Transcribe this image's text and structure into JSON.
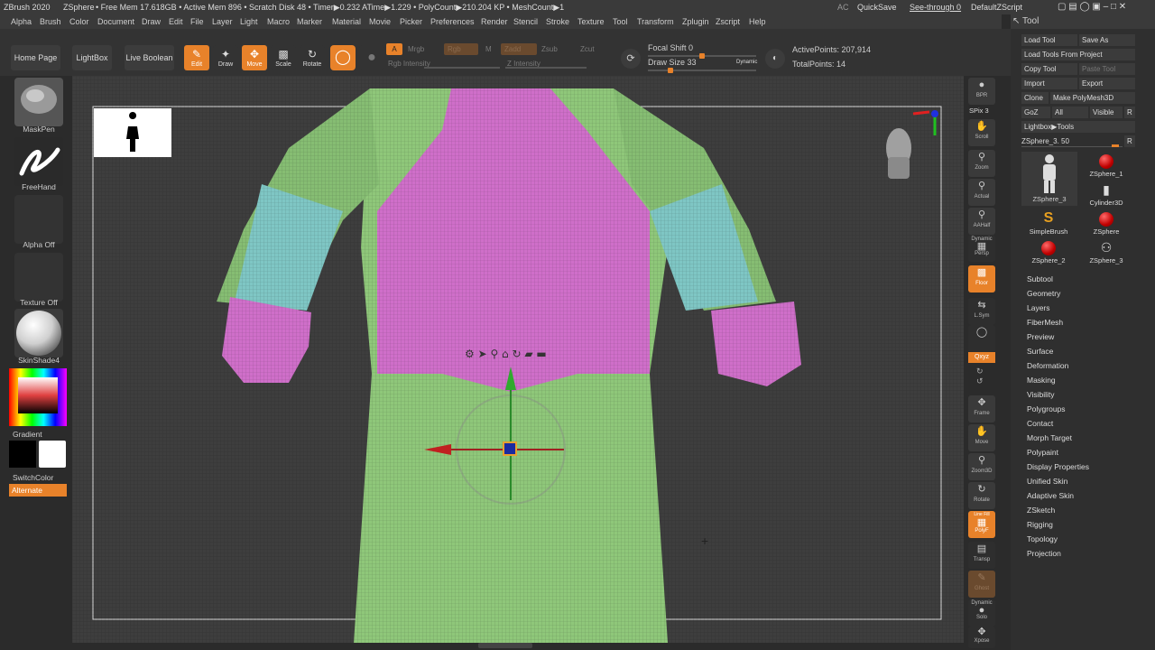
{
  "titlebar": {
    "app": "ZBrush 2020",
    "tool": "ZSphere",
    "stats": "• Free Mem 17.618GB • Active Mem 896 • Scratch Disk 48 • Timer▶0.232 ATime▶1.229 • PolyCount▶210.204 KP • MeshCount▶1",
    "ac": "AC",
    "quicksave": "QuickSave",
    "see_through": "See-through  0",
    "default_script": "DefaultZScript"
  },
  "menu": [
    "Alpha",
    "Brush",
    "Color",
    "Document",
    "Draw",
    "Edit",
    "File",
    "Layer",
    "Light",
    "Macro",
    "Marker",
    "Material",
    "Movie",
    "Picker",
    "Preferences",
    "Render",
    "Stencil",
    "Stroke",
    "Texture",
    "Tool",
    "Transform",
    "Zplugin",
    "Zscript",
    "Help"
  ],
  "toolbar": {
    "home_page": "Home Page",
    "lightbox": "LightBox",
    "live_boolean": "Live Boolean",
    "edit": "Edit",
    "draw": "Draw",
    "move": "Move",
    "scale": "Scale",
    "rotate": "Rotate",
    "a_label": "A",
    "mrgb": "Mrgb",
    "rgb": "Rgb",
    "m": "M",
    "zadd": "Zadd",
    "zsub": "Zsub",
    "zcut": "Zcut",
    "rgb_intensity": "Rgb Intensity",
    "z_intensity": "Z Intensity",
    "focal_shift": "Focal Shift 0",
    "draw_size": "Draw Size 33",
    "dynamic": "Dynamic",
    "active_points": "ActivePoints: 207,914",
    "total_points": "TotalPoints: 14"
  },
  "left": {
    "brush": "MaskPen",
    "stroke": "FreeHand",
    "alpha": "Alpha Off",
    "texture": "Texture Off",
    "material": "SkinShade4",
    "gradient": "Gradient",
    "switchcolor": "SwitchColor",
    "alternate": "Alternate"
  },
  "right": {
    "bpr": "BPR",
    "spix": "SPix 3",
    "scroll": "Scroll",
    "zoom": "Zoom",
    "actual": "Actual",
    "aahalf": "AAHalf",
    "dynamic": "Dynamic",
    "persp": "Persp",
    "floor": "Floor",
    "lsym": "L.Sym",
    "xyz": "Qxyz",
    "frame": "Frame",
    "move": "Move",
    "zoom3d": "Zoom3D",
    "rotate": "Rotate",
    "linefill": "Line Fill",
    "polyf": "PolyF",
    "transp": "Transp",
    "ghost": "Ghost",
    "solo": "Solo",
    "xpose": "Xpose"
  },
  "toolpanel": {
    "title": "Tool",
    "load_tool": "Load Tool",
    "save_as": "Save As",
    "load_from_project": "Load Tools From Project",
    "copy_tool": "Copy Tool",
    "paste_tool": "Paste Tool",
    "import": "Import",
    "export": "Export",
    "clone": "Clone",
    "make_polymesh": "Make PolyMesh3D",
    "goz": "GoZ",
    "all": "All",
    "visible": "Visible",
    "r": "R",
    "lightbox_tools": "Lightbox▶Tools",
    "current_tool": "ZSphere_3. 50",
    "thumbs": [
      "ZSphere_1",
      "ZSphere_3",
      "Cylinder3D",
      "SimpleBrush",
      "ZSphere",
      "ZSphere_2",
      "ZSphere_3"
    ],
    "menus": [
      "Subtool",
      "Geometry",
      "Layers",
      "FiberMesh",
      "Preview",
      "Surface",
      "Deformation",
      "Masking",
      "Visibility",
      "Polygroups",
      "Contact",
      "Morph Target",
      "Polypaint",
      "Display Properties",
      "Unified Skin",
      "Adaptive Skin",
      "ZSketch",
      "Rigging",
      "Topology",
      "Projection"
    ]
  },
  "colors": {
    "accent": "#e8822a",
    "mesh_green": "#8fc77a",
    "mesh_pink": "#cf6fc9",
    "mesh_cyan": "#7fc6c4"
  }
}
